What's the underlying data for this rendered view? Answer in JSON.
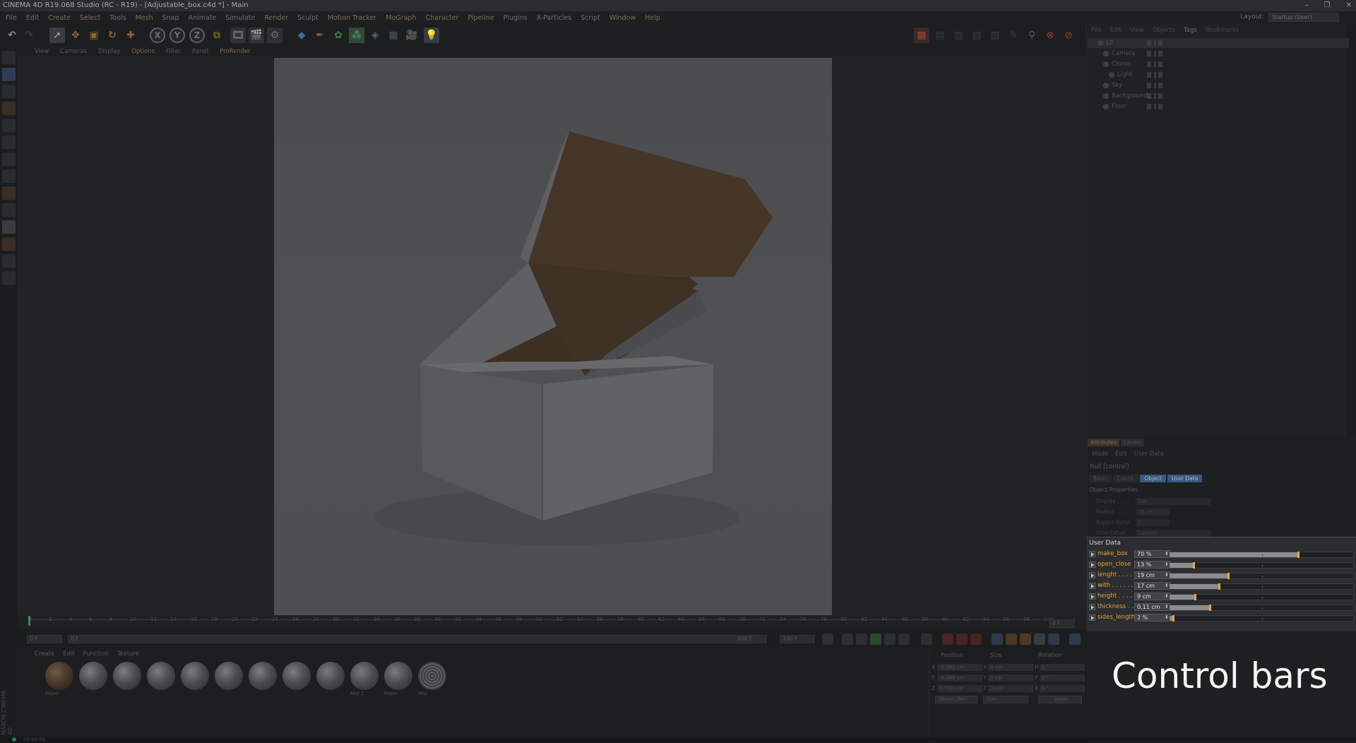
{
  "window": {
    "title": "CINEMA 4D R19.068 Studio (RC - R19) - [Adjustable_box.c4d *] - Main",
    "controls": [
      "–",
      "❐",
      "✕"
    ]
  },
  "menubar": {
    "items": [
      "File",
      "Edit",
      "Create",
      "Select",
      "Tools",
      "Mesh",
      "Snap",
      "Animate",
      "Simulate",
      "Render",
      "Sculpt",
      "Motion Tracker",
      "MoGraph",
      "Character",
      "Pipeline",
      "Plugins",
      "X-Particles",
      "Script",
      "Window",
      "Help"
    ],
    "layout_label": "Layout:",
    "layout_value": "Startup (User)"
  },
  "toolbar": {
    "axis_x": "X",
    "axis_y": "Y",
    "axis_z": "Z"
  },
  "viewport": {
    "menu": [
      "View",
      "Cameras",
      "Display",
      "Options",
      "Filter",
      "Panel",
      "ProRender"
    ]
  },
  "timeline": {
    "ticks": [
      "0",
      "2",
      "4",
      "6",
      "8",
      "10",
      "12",
      "14",
      "16",
      "18",
      "20",
      "22",
      "24",
      "26",
      "28",
      "30",
      "32",
      "34",
      "36",
      "38",
      "40",
      "42",
      "44",
      "46",
      "48",
      "50",
      "52",
      "54",
      "56",
      "58",
      "60",
      "62",
      "64",
      "66",
      "68",
      "70",
      "72",
      "74",
      "76",
      "78",
      "80",
      "82",
      "84",
      "86",
      "88",
      "90",
      "92",
      "94",
      "96",
      "98",
      "100"
    ],
    "start_field": "0 F",
    "range_start": "0 F",
    "range_end": "100 F",
    "end_field": "100 F",
    "current_frame": "0 F"
  },
  "materials": {
    "menu": [
      "Create",
      "Edit",
      "Function",
      "Texture"
    ],
    "items": [
      {
        "label": "Paper",
        "kind": "brown"
      },
      {
        "label": "",
        "kind": "grey"
      },
      {
        "label": "",
        "kind": "grey"
      },
      {
        "label": "",
        "kind": "grey"
      },
      {
        "label": "",
        "kind": "grey"
      },
      {
        "label": "",
        "kind": "grey"
      },
      {
        "label": "",
        "kind": "grey"
      },
      {
        "label": "",
        "kind": "grey"
      },
      {
        "label": "",
        "kind": "grey"
      },
      {
        "label": "Mat.1",
        "kind": "grey"
      },
      {
        "label": "Paper",
        "kind": "grey"
      },
      {
        "label": "Mat",
        "kind": "pattern"
      }
    ]
  },
  "coordinates": {
    "headers": [
      "Position",
      "Size",
      "Rotation"
    ],
    "rows": [
      {
        "axis": "X",
        "pos": "-0.993 cm",
        "size_axis": "X",
        "size": "0 cm",
        "rot_axis": "H",
        "rot": "0 °"
      },
      {
        "axis": "Y",
        "pos": "-0.446 cm",
        "size_axis": "Y",
        "size": "0 cm",
        "rot_axis": "P",
        "rot": "0 °"
      },
      {
        "axis": "Z",
        "pos": "0.772 cm",
        "size_axis": "Z",
        "size": "0 cm",
        "rot_axis": "B",
        "rot": "0 °"
      }
    ],
    "mode": "Object (Rel)",
    "size_mode": "Size",
    "apply": "Apply"
  },
  "status": {
    "time": "00:00:02"
  },
  "object_manager": {
    "menu": [
      "File",
      "Edit",
      "View",
      "Objects",
      "Tags",
      "Bookmarks"
    ],
    "objects": [
      {
        "name": "L0",
        "indent": 0,
        "selected": true
      },
      {
        "name": "Camera",
        "indent": 1,
        "selected": false
      },
      {
        "name": "Cloner",
        "indent": 1,
        "selected": false
      },
      {
        "name": "Light",
        "indent": 2,
        "selected": false
      },
      {
        "name": "Sky",
        "indent": 1,
        "selected": false
      },
      {
        "name": "Background",
        "indent": 1,
        "selected": false
      },
      {
        "name": "Floor",
        "indent": 1,
        "selected": false
      }
    ]
  },
  "attribute_manager": {
    "tabs": [
      "Attributes",
      "Layers"
    ],
    "menu": [
      "Mode",
      "Edit",
      "User Data"
    ],
    "title": "Null [control]",
    "subtabs": [
      "Basic",
      "Coord.",
      "Object",
      "User Data"
    ],
    "section": "Object Properties",
    "object_props": [
      {
        "label": "Display . . . .",
        "value": "Dot"
      },
      {
        "label": "Radius . . . .",
        "value": "10 cm"
      },
      {
        "label": "Aspect Ratio",
        "value": "1"
      },
      {
        "label": "Orientation",
        "value": "Camera"
      }
    ]
  },
  "user_data": {
    "title": "User Data",
    "params": [
      {
        "name": "make_box",
        "value": "70 %",
        "fraction": 0.7
      },
      {
        "name": "open_close",
        "value": "13 %",
        "fraction": 0.13
      },
      {
        "name": "lenght . . . .",
        "value": "19 cm",
        "fraction": 0.32
      },
      {
        "name": "with . . . . . .",
        "value": "17 cm",
        "fraction": 0.27
      },
      {
        "name": "height . . . .",
        "value": "9 cm",
        "fraction": 0.14
      },
      {
        "name": "thickness . .",
        "value": "0.11 cm",
        "fraction": 0.22
      },
      {
        "name": "sides_length",
        "value": "2 %",
        "fraction": 0.02
      }
    ],
    "accent": "#f0a638"
  },
  "caption": {
    "text": "Control bars"
  }
}
